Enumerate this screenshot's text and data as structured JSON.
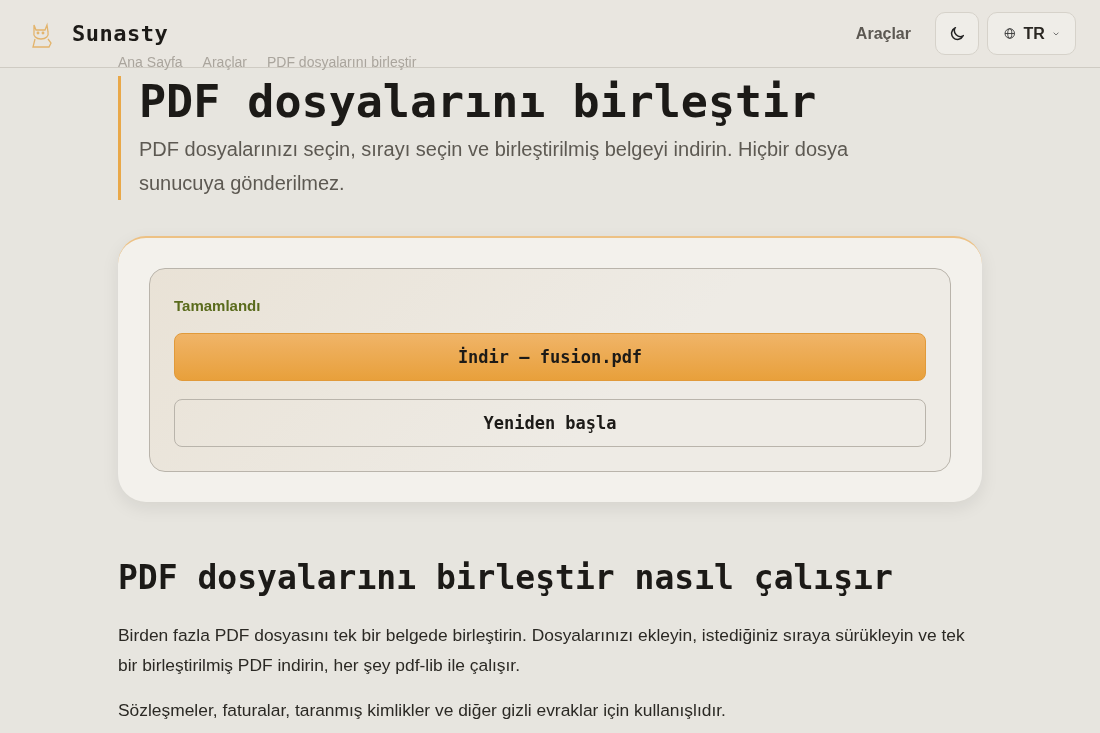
{
  "header": {
    "brand": "Sunasty",
    "nav_link": "Araçlar",
    "language": "TR"
  },
  "breadcrumb": [
    "Ana Sayfa",
    "Araçlar",
    "PDF dosyalarını birleştir"
  ],
  "title": "PDF dosyalarını birleştir",
  "subtitle": "PDF dosyalarınızı seçin, sırayı seçin ve birleştirilmiş belgeyi indirin. Hiçbir dosya sunucuya gönderilmez.",
  "result": {
    "status": "Tamamlandı",
    "download_button": "İndir — fusion.pdf",
    "restart_button": "Yeniden başla"
  },
  "how_it_works": {
    "heading": "PDF dosyalarını birleştir nasıl çalışır",
    "paragraphs": [
      "Birden fazla PDF dosyasını tek bir belgede birleştirin. Dosyalarınızı ekleyin, istediğiniz sıraya sürükleyin ve tek bir birleştirilmiş PDF indirin, her şey pdf-lib ile çalışır.",
      "Sözleşmeler, faturalar, taranmış kimlikler ve diğer gizli evraklar için kullanışlıdır."
    ]
  }
}
